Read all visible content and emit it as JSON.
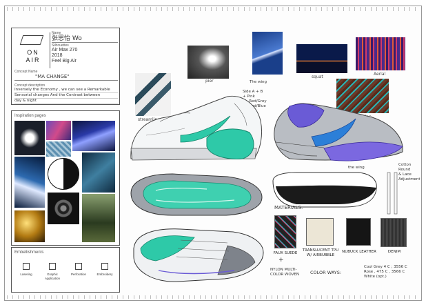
{
  "title_block": {
    "logo_text_1": "ON",
    "logo_text_2": "AIR",
    "name_label": "Name",
    "name_value": "张思怡 Wo",
    "silhouette_label": "Silhouettes",
    "silhouette_lines": [
      "Air Max 270",
      "2018",
      "Feel Big Air"
    ],
    "concept_name_label": "Concept Name",
    "concept_name_value": "\"MA CHANGE\"",
    "concept_desc_label": "Concept description",
    "concept_desc_lines": [
      "Inversely the Economy , we can see a Remarkable",
      "Sensorial changes And the Contrast between",
      "day & night"
    ]
  },
  "inspiration": {
    "title": "Inspiration pages"
  },
  "embellishments": {
    "title": "Embellishments",
    "items": [
      "Lasering",
      "Graphic Application",
      "Perforation",
      "Embroidery"
    ]
  },
  "annotations": {
    "ref_1": "pier",
    "ref_2": "squat",
    "ref_3": "Aerial",
    "ref_4": "gradation",
    "ref_5": "streamline",
    "heel_notes": [
      "Side A + B",
      "+ Pink",
      "A - Red/Grey",
      "B - Red/Blue"
    ],
    "tongue_note": "The wing",
    "outsole_note": "the wing",
    "lace_note": [
      "Cotton",
      "Round",
      "& Lace",
      "Adjustment"
    ]
  },
  "materials": {
    "title": "MATERIALS:",
    "items": [
      {
        "label": "FAUX SUEDE",
        "color": "#2a2a2a"
      },
      {
        "label": "TRANSLUCENT TPU W/ AIRBUBBLE",
        "color": "#ece6d6"
      },
      {
        "label": "NUBUCK LEATHER",
        "color": "#151515"
      },
      {
        "label": "DENIM",
        "color": "#3a3a3a"
      }
    ],
    "plus_sign": "+",
    "mesh_note": [
      "NYLON MULTI-",
      "COLOR WOVEN"
    ],
    "colorways_label": "COLOR WAYS:",
    "colorway_notes": [
      "Cool Grey 4 C ; 3556 C",
      "Rose , 475 C , 3566 C",
      "White (opt.)"
    ]
  },
  "colors": {
    "teal": "#2ec9a8",
    "purple": "#6a5bd6",
    "blue": "#2c7fd8",
    "grey": "#8b8f96"
  }
}
